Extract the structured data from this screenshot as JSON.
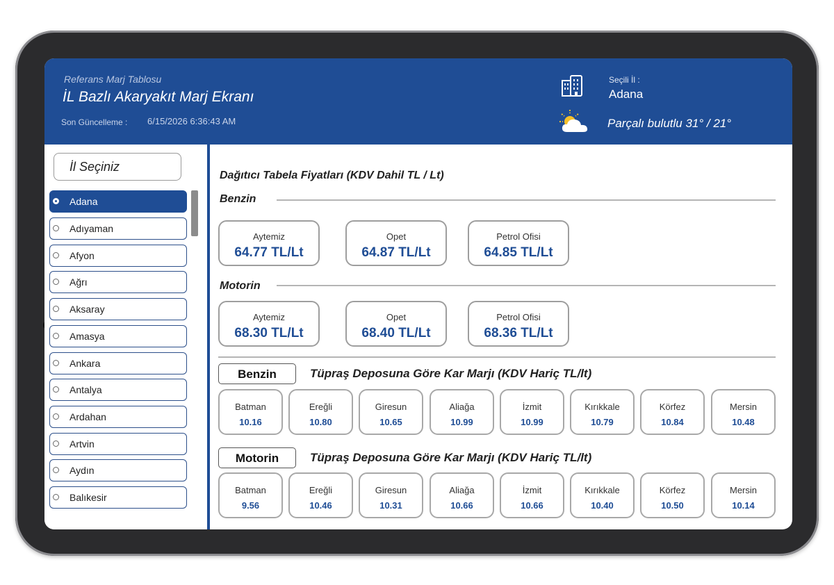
{
  "header": {
    "subtitle": "Referans Marj Tablosu",
    "title": "İL Bazlı Akaryakıt Marj Ekranı",
    "last_update_label": "Son Güncelleme :",
    "last_update_value": "6/15/2026 6:36:43 AM",
    "selected_city_label": "Seçili İl :",
    "selected_city": "Adana",
    "weather": "Parçalı bulutlu 31° / 21°",
    "icons": [
      "building-icon",
      "partly-cloudy-icon"
    ]
  },
  "sidebar": {
    "city_select_label": "İl Seçiniz",
    "selected_index": 0,
    "cities": [
      "Adana",
      "Adıyaman",
      "Afyon",
      "Ağrı",
      "Aksaray",
      "Amasya",
      "Ankara",
      "Antalya",
      "Ardahan",
      "Artvin",
      "Aydın",
      "Balıkesir"
    ]
  },
  "prices": {
    "title": "Dağıtıcı Tabela Fiyatları (KDV Dahil TL / Lt)",
    "benzin": {
      "label": "Benzin",
      "items": [
        {
          "brand": "Aytemiz",
          "price": "64.77 TL/Lt"
        },
        {
          "brand": "Opet",
          "price": "64.87 TL/Lt"
        },
        {
          "brand": "Petrol Ofisi",
          "price": "64.85 TL/Lt"
        }
      ]
    },
    "motorin": {
      "label": "Motorin",
      "items": [
        {
          "brand": "Aytemiz",
          "price": "68.30 TL/Lt"
        },
        {
          "brand": "Opet",
          "price": "68.40 TL/Lt"
        },
        {
          "brand": "Petrol Ofisi",
          "price": "68.36 TL/Lt"
        }
      ]
    }
  },
  "margins": {
    "title": "Tüpraş Deposuna Göre Kar Marjı (KDV Hariç TL/lt)",
    "benzin": {
      "label": "Benzin",
      "items": [
        {
          "depot": "Batman",
          "value": "10.16"
        },
        {
          "depot": "Ereğli",
          "value": "10.80"
        },
        {
          "depot": "Giresun",
          "value": "10.65"
        },
        {
          "depot": "Aliağa",
          "value": "10.99"
        },
        {
          "depot": "İzmit",
          "value": "10.99"
        },
        {
          "depot": "Kırıkkale",
          "value": "10.79"
        },
        {
          "depot": "Körfez",
          "value": "10.84"
        },
        {
          "depot": "Mersin",
          "value": "10.48"
        }
      ]
    },
    "motorin": {
      "label": "Motorin",
      "items": [
        {
          "depot": "Batman",
          "value": "9.56"
        },
        {
          "depot": "Ereğli",
          "value": "10.46"
        },
        {
          "depot": "Giresun",
          "value": "10.31"
        },
        {
          "depot": "Aliağa",
          "value": "10.66"
        },
        {
          "depot": "İzmit",
          "value": "10.66"
        },
        {
          "depot": "Kırıkkale",
          "value": "10.40"
        },
        {
          "depot": "Körfez",
          "value": "10.50"
        },
        {
          "depot": "Mersin",
          "value": "10.14"
        }
      ]
    }
  },
  "colors": {
    "brand_blue": "#1f4d95",
    "card_border": "#9e9e9e"
  }
}
